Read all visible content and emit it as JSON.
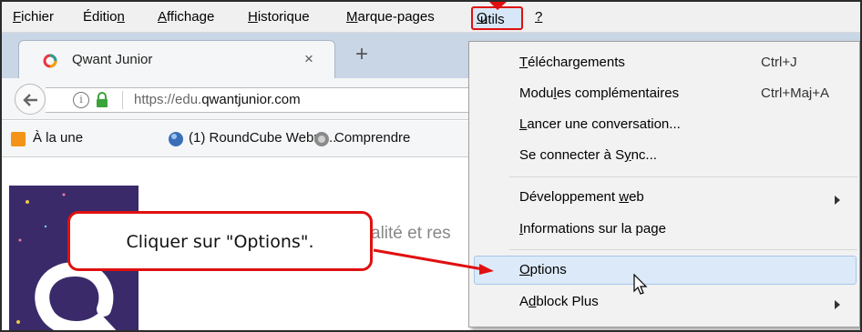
{
  "menubar": {
    "items": [
      {
        "pre": "",
        "u": "F",
        "post": "ichier"
      },
      {
        "pre": "Éditio",
        "u": "n",
        "post": ""
      },
      {
        "pre": "",
        "u": "A",
        "post": "ffichage"
      },
      {
        "pre": "",
        "u": "H",
        "post": "istorique"
      },
      {
        "pre": "",
        "u": "M",
        "post": "arque-pages"
      },
      {
        "pre": "",
        "u": "O",
        "post": "utils"
      },
      {
        "pre": "",
        "u": "?",
        "post": ""
      }
    ]
  },
  "tab": {
    "title": "Qwant Junior",
    "close": "×",
    "new_tab": "+"
  },
  "navbar": {
    "url_prefix": "https://edu.",
    "url_domain": "qwantjunior.com"
  },
  "bookmarks": {
    "items": [
      "À la une",
      "(1) RoundCube Webm...",
      "Comprendre"
    ]
  },
  "page": {
    "partial_text": "alité et res"
  },
  "tools_menu": {
    "items": [
      {
        "pre": "",
        "u": "T",
        "post": "éléchargements",
        "shortcut": "Ctrl+J"
      },
      {
        "pre": "Modu",
        "u": "l",
        "post": "es complémentaires",
        "shortcut": "Ctrl+Maj+A"
      },
      {
        "pre": "",
        "u": "L",
        "post": "ancer une conversation...",
        "shortcut": ""
      },
      {
        "pre": "Se connecter à S",
        "u": "y",
        "post": "nc...",
        "shortcut": ""
      },
      {
        "pre": "Développement ",
        "u": "w",
        "post": "eb",
        "shortcut": ""
      },
      {
        "pre": "",
        "u": "I",
        "post": "nformations sur la page",
        "shortcut": ""
      },
      {
        "pre": "",
        "u": "O",
        "post": "ptions",
        "shortcut": ""
      },
      {
        "pre": "A",
        "u": "d",
        "post": "block Plus",
        "shortcut": ""
      }
    ]
  },
  "callout": {
    "text": "Cliquer sur \"Options\"."
  },
  "colors": {
    "annotation_red": "#e01010",
    "highlight": "#dbe9f8",
    "tabstrip": "#c9d6e6",
    "qwant_panel": "#3a2a6a"
  }
}
